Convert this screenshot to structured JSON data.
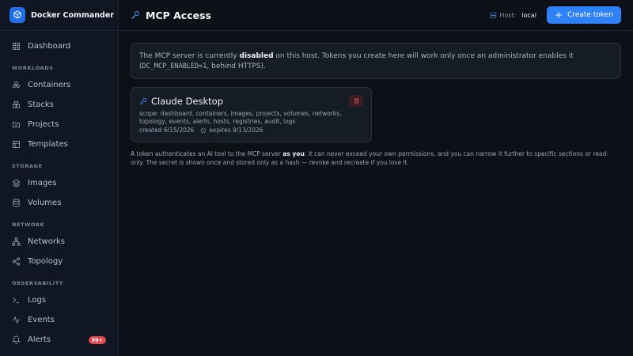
{
  "app": {
    "name": "Docker Commander"
  },
  "sidebar": {
    "dashboard": "Dashboard",
    "sections": {
      "workloads": "WORKLOADS",
      "storage": "STORAGE",
      "network": "NETWORK",
      "observability": "OBSERVABILITY"
    },
    "items": {
      "containers": "Containers",
      "stacks": "Stacks",
      "projects": "Projects",
      "templates": "Templates",
      "images": "Images",
      "volumes": "Volumes",
      "networks": "Networks",
      "topology": "Topology",
      "logs": "Logs",
      "events": "Events",
      "alerts": "Alerts"
    },
    "alerts_badge": "99+"
  },
  "header": {
    "title": "MCP Access",
    "host_label": "Host:",
    "host_value": "local",
    "create_button": "Create token"
  },
  "notice": {
    "prefix": "The MCP server is currently ",
    "status": "disabled",
    "middle": " on this host. Tokens you create here will work only once an administrator enables it (",
    "env_var": "DC_MCP_ENABLED=1",
    "suffix": ", behind HTTPS)."
  },
  "tokens": [
    {
      "name": "Claude Desktop",
      "scope": "scope: dashboard, containers, images, projects, volumes, networks, topology, events, alerts, hosts, registries, audit, logs",
      "created": "created 6/15/2026",
      "expires": "expires 9/13/2026"
    }
  ],
  "footnote": {
    "prefix": "A token authenticates an AI tool to the MCP server ",
    "emphasis": "as you",
    "suffix": ": it can never exceed your own permissions, and you can narrow it further to specific sections or read-only. The secret is shown once and stored only as a hash — revoke and recreate if you lose it."
  },
  "colors": {
    "accent": "#2f81f7",
    "background": "#0d1117",
    "danger": "#e5484d"
  }
}
